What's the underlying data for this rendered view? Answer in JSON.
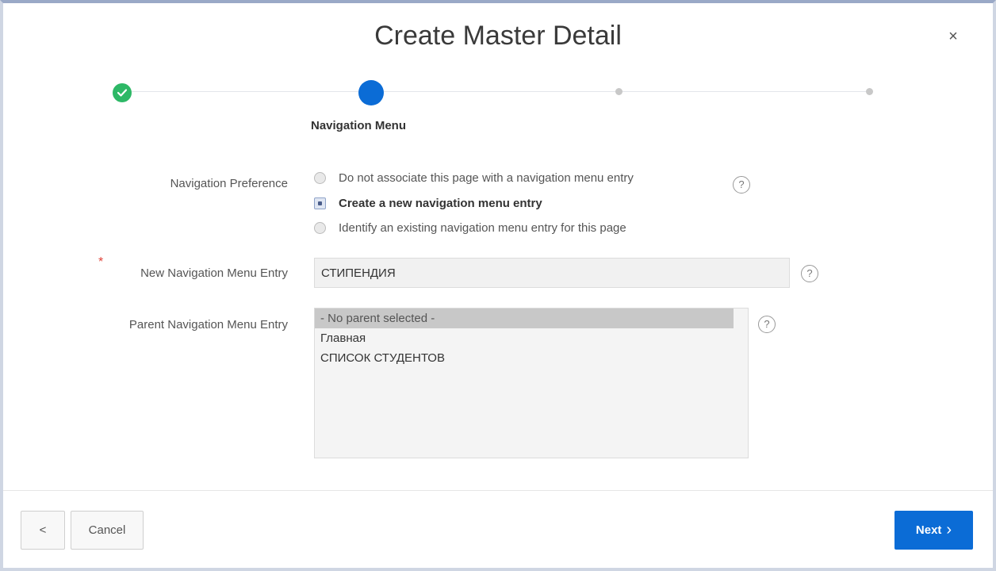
{
  "dialog": {
    "title": "Create Master Detail",
    "close_glyph": "×"
  },
  "progress": {
    "current_step_label": "Navigation Menu",
    "steps_total": 4,
    "current_step": 2,
    "colors": {
      "done": "#2db866",
      "current": "#0b6cd6",
      "pending": "#c8c8c8"
    }
  },
  "form": {
    "navigation_preference": {
      "label": "Navigation Preference",
      "options": [
        {
          "label": "Do not associate this page with a navigation menu entry",
          "selected": false
        },
        {
          "label": "Create a new navigation menu entry",
          "selected": true
        },
        {
          "label": "Identify an existing navigation menu entry for this page",
          "selected": false
        }
      ],
      "help_glyph": "?"
    },
    "new_entry": {
      "label": "New Navigation Menu Entry",
      "required_mark": "*",
      "value": "СТИПЕНДИЯ",
      "help_glyph": "?"
    },
    "parent_entry": {
      "label": "Parent Navigation Menu Entry",
      "options": [
        {
          "label": "- No parent selected -",
          "selected": true
        },
        {
          "label": "Главная",
          "selected": false
        },
        {
          "label": "СПИСОК СТУДЕНТОВ",
          "selected": false
        }
      ],
      "help_glyph": "?"
    }
  },
  "footer": {
    "back_glyph": "<",
    "cancel_label": "Cancel",
    "next_label": "Next",
    "next_glyph": "›"
  }
}
